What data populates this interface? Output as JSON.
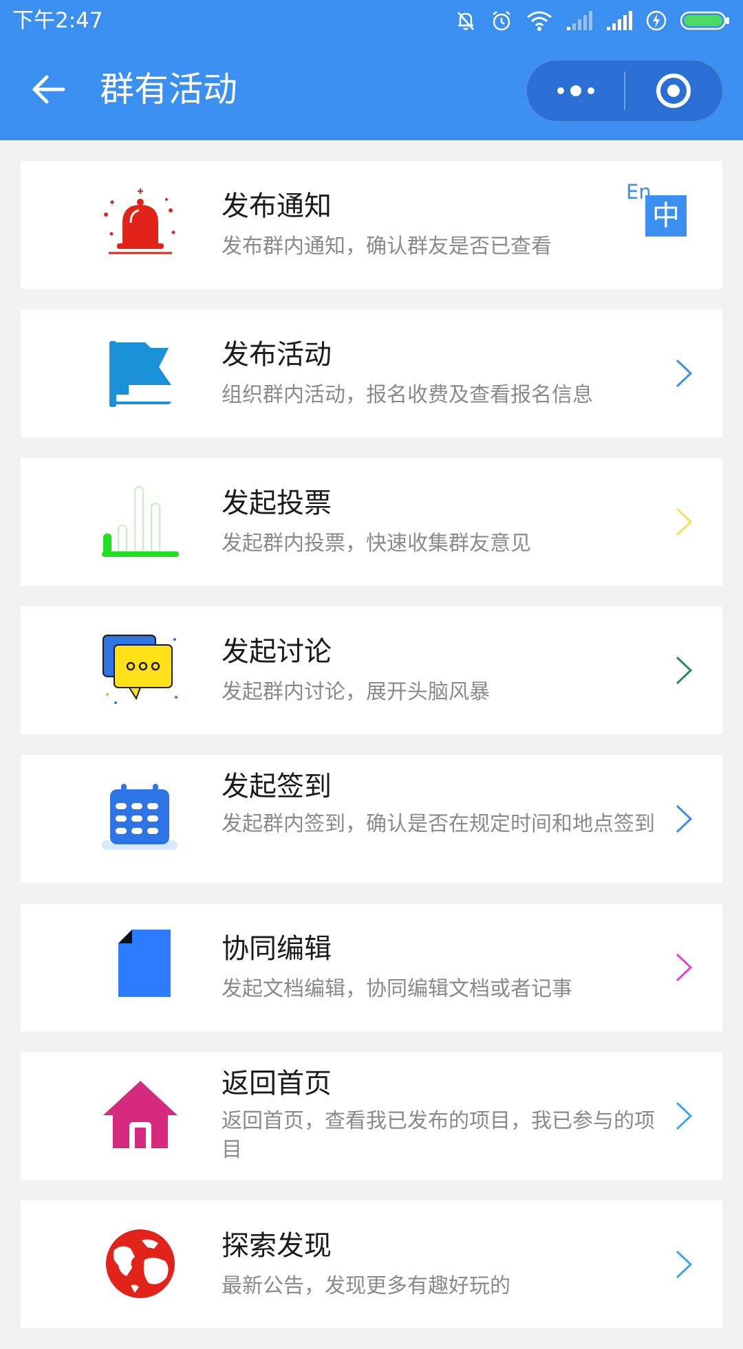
{
  "status_bar": {
    "time": "下午2:47"
  },
  "nav": {
    "title": "群有活动",
    "back_icon": "arrow-left-icon",
    "more_icon": "more-dots-icon",
    "close_icon": "target-close-icon"
  },
  "lang_badge": {
    "en": "En",
    "zh": "中"
  },
  "colors": {
    "header": "#3b8ff0",
    "background": "#f2f2f2",
    "card": "#ffffff",
    "title_text": "#1a1a1a",
    "desc_text": "#8a8a8a"
  },
  "items": [
    {
      "title": "发布通知",
      "desc": "发布群内通知，确认群友是否已查看",
      "icon": "bell-icon",
      "chevron_color": ""
    },
    {
      "title": "发布活动",
      "desc": "组织群内活动，报名收费及查看报名信息",
      "icon": "flag-icon",
      "chevron_color": "#3b8ff0"
    },
    {
      "title": "发起投票",
      "desc": "发起群内投票，快速收集群友意见",
      "icon": "bar-chart-icon",
      "chevron_color": "#f5e15a"
    },
    {
      "title": "发起讨论",
      "desc": "发起群内讨论，展开头脑风暴",
      "icon": "chat-bubbles-icon",
      "chevron_color": "#2e8b57"
    },
    {
      "title": "发起签到",
      "desc": "发起群内签到，确认是否在规定时间和地点签到",
      "icon": "calendar-icon",
      "chevron_color": "#3b8ff0"
    },
    {
      "title": "协同编辑",
      "desc": "发起文档编辑，协同编辑文档或者记事",
      "icon": "document-icon",
      "chevron_color": "#e040e0"
    },
    {
      "title": "返回首页",
      "desc": "返回首页，查看我已发布的项目，我已参与的项目",
      "icon": "home-icon",
      "chevron_color": "#3ba8e8"
    },
    {
      "title": "探索发现",
      "desc": "最新公告，发现更多有趣好玩的",
      "icon": "globe-icon",
      "chevron_color": "#3ba8e8"
    }
  ]
}
